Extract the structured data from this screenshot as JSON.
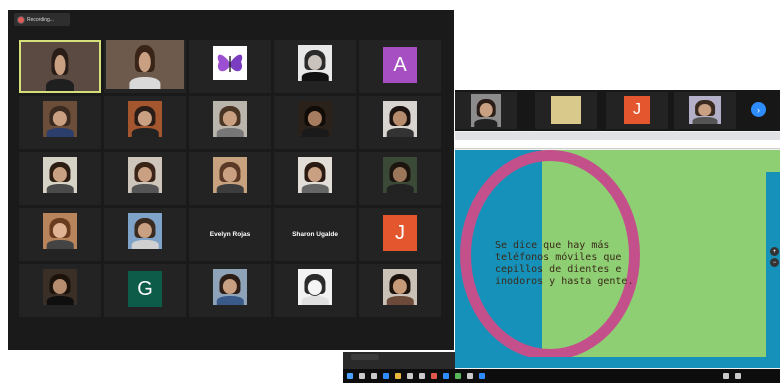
{
  "recording": {
    "label": "Recording..."
  },
  "gallery": {
    "named_tiles": [
      "Evelyn Rojas",
      "Sharon Ugalde"
    ],
    "letter_tiles": [
      {
        "letter": "A",
        "color": "#a64fc2"
      },
      {
        "letter": "J",
        "color": "#e4572e"
      },
      {
        "letter": "G",
        "color": "#0d5c4a"
      }
    ]
  },
  "share_strip": {
    "letter": "J",
    "letter_color": "#e4572e",
    "next_icon": "chevron-right-icon"
  },
  "slide": {
    "text_lines": [
      "Se dice que hay más",
      "teléfonos móviles que",
      "cepillos de dientes e",
      "inodoros y hasta gente."
    ],
    "colors": {
      "green": "#8ecf73",
      "blue": "#1691b9",
      "ring": "#c4508b"
    }
  },
  "colors": {
    "zoom_bg": "#1a1a1a",
    "tile_bg": "#232323",
    "active_speaker": "#d6e07a"
  }
}
